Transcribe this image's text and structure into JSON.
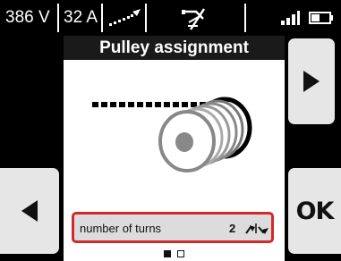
{
  "status": {
    "voltage": "386 V",
    "current": "32 A",
    "icons": [
      "wire-feed-icon",
      "no-gas-icon",
      "signal-strength-icon",
      "battery-icon"
    ]
  },
  "screen": {
    "title": "Pulley assignment",
    "illustration": "pulley-wire-icon",
    "turns_field": {
      "label": "number of turns",
      "value": "2",
      "icon": "turn-arrows-icon"
    },
    "page_indicator": {
      "total": 2,
      "current": 1
    }
  },
  "buttons": {
    "next_icon": "arrow-right-icon",
    "prev_icon": "arrow-left-icon",
    "ok_label": "OK"
  },
  "colors": {
    "background": "#000000",
    "title_bar": "#1a1a1a",
    "highlight_border": "#d02a2a",
    "button": "#e6e6e6",
    "field": "#dcdcdc"
  }
}
